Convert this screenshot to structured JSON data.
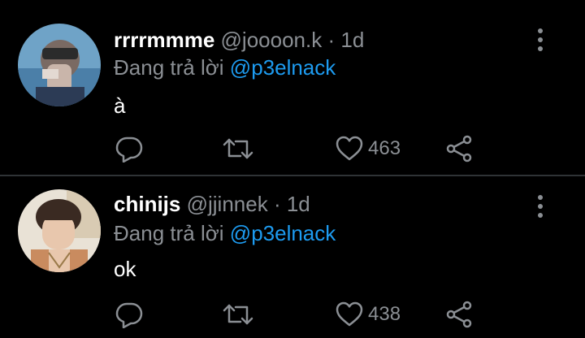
{
  "tweets": [
    {
      "display_name": "rrrrmmme",
      "handle": "@joooon.k",
      "separator": "·",
      "time": "1d",
      "reply_prefix": "Đang trả lời",
      "reply_to": "@p3elnack",
      "text": "à",
      "likes": "463"
    },
    {
      "display_name": "chinijs",
      "handle": "@jjinnek",
      "separator": "·",
      "time": "1d",
      "reply_prefix": "Đang trả lời",
      "reply_to": "@p3elnack",
      "text": "ok",
      "likes": "438"
    }
  ],
  "icons": {
    "reply": "reply-icon",
    "retweet": "retweet-icon",
    "like": "heart-icon",
    "share": "share-icon",
    "more": "more-vertical-icon"
  },
  "colors": {
    "background": "#000000",
    "text": "#ffffff",
    "muted": "#8b8f94",
    "link": "#1d9bf0",
    "divider": "#2f3336"
  }
}
